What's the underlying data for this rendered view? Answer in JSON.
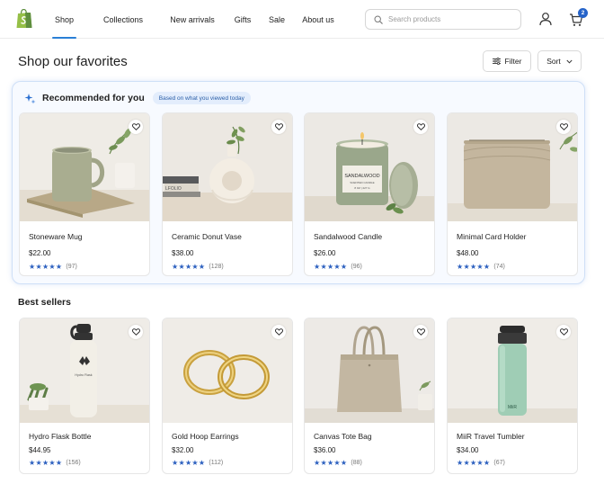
{
  "header": {
    "logo_icon": "shopify-bag-icon",
    "nav": [
      {
        "label": "Shop",
        "active": true
      },
      {
        "label": "Collections",
        "active": false
      },
      {
        "label": "New arrivals",
        "active": false
      },
      {
        "label": "Gifts",
        "active": false
      },
      {
        "label": "Sale",
        "active": false
      },
      {
        "label": "About us",
        "active": false
      }
    ],
    "search_placeholder": "Search products",
    "cart_count": "2"
  },
  "page": {
    "title": "Shop our favorites",
    "filter_label": "Filter",
    "sort_label": "Sort"
  },
  "recommended": {
    "title": "Recommended for you",
    "chip": "Based on what you viewed today",
    "items": [
      {
        "name": "Stoneware Mug",
        "price": "$22.00",
        "stars": "★★★★★",
        "rating": 4.5,
        "count": "(97)"
      },
      {
        "name": "Ceramic Donut Vase",
        "price": "$38.00",
        "stars": "★★★★★",
        "rating": 4.5,
        "count": "(128)"
      },
      {
        "name": "Sandalwood Candle",
        "price": "$26.00",
        "stars": "★★★★★",
        "rating": 4.5,
        "count": "(96)",
        "label_top": "SANDALWOOD",
        "label_sub": "SCENTED CANDLE",
        "label_weight": "8 OZ | 227 G"
      },
      {
        "name": "Minimal Card Holder",
        "price": "$48.00",
        "stars": "★★★★★",
        "rating": 4.5,
        "count": "(74)"
      }
    ]
  },
  "best_sellers": {
    "title": "Best sellers",
    "items": [
      {
        "name": "Hydro Flask Bottle",
        "price": "$44.95",
        "stars": "★★★★★",
        "rating": 4.5,
        "count": "(156)",
        "bottle_text": "Hydro Flask"
      },
      {
        "name": "Gold Hoop Earrings",
        "price": "$32.00",
        "stars": "★★★★★",
        "rating": 4.5,
        "count": "(112)"
      },
      {
        "name": "Canvas Tote Bag",
        "price": "$36.00",
        "stars": "★★★★★",
        "rating": 4.5,
        "count": "(88)"
      },
      {
        "name": "MiiR Travel Tumbler",
        "price": "$34.00",
        "stars": "★★★★★",
        "rating": 4.5,
        "count": "(67)",
        "tumbler_text": "MiiR"
      }
    ]
  },
  "colors": {
    "accent": "#2a7fd6",
    "star": "#2b5fbf",
    "badge": "#2563c9",
    "panel_bg": "#f7faff",
    "panel_border": "#cfe0f7"
  }
}
